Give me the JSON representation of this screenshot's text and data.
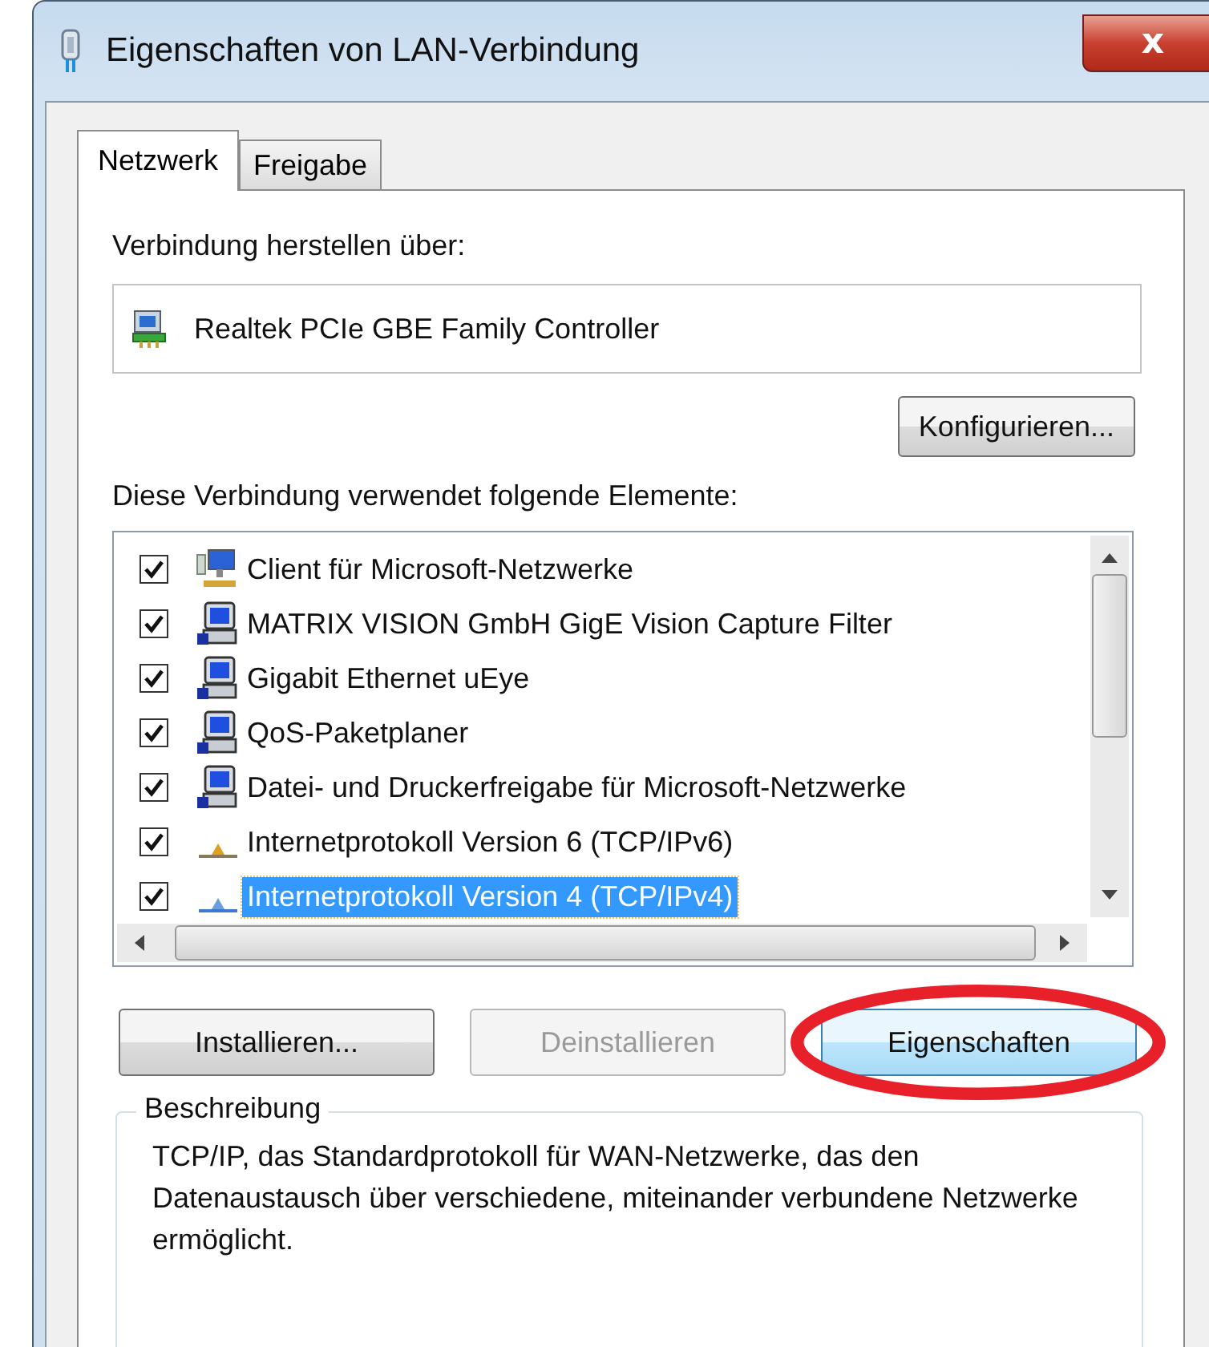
{
  "window": {
    "title": "Eigenschaften von LAN-Verbindung",
    "close_label": "x"
  },
  "tabs": [
    {
      "label": "Netzwerk",
      "selected": true
    },
    {
      "label": "Freigabe",
      "selected": false
    }
  ],
  "connect_label": "Verbindung herstellen über:",
  "adapter": "Realtek PCIe GBE Family Controller",
  "configure_button": "Konfigurieren...",
  "elements_label": "Diese Verbindung verwendet folgende Elemente:",
  "elements": [
    {
      "label": "Client für Microsoft-Netzwerke",
      "kind": "client",
      "checked": true,
      "selected": false
    },
    {
      "label": "MATRIX VISION GmbH GigE Vision Capture Filter",
      "kind": "service",
      "checked": true,
      "selected": false
    },
    {
      "label": "Gigabit Ethernet uEye",
      "kind": "service",
      "checked": true,
      "selected": false
    },
    {
      "label": "QoS-Paketplaner",
      "kind": "service",
      "checked": true,
      "selected": false
    },
    {
      "label": "Datei- und Druckerfreigabe für Microsoft-Netzwerke",
      "kind": "service",
      "checked": true,
      "selected": false
    },
    {
      "label": "Internetprotokoll Version 6 (TCP/IPv6)",
      "kind": "protocol",
      "checked": true,
      "selected": false
    },
    {
      "label": "Internetprotokoll Version 4 (TCP/IPv4)",
      "kind": "protocol",
      "checked": true,
      "selected": true
    }
  ],
  "buttons": [
    {
      "label": "Installieren...",
      "disabled": false,
      "focused": false
    },
    {
      "label": "Deinstallieren",
      "disabled": true,
      "focused": false
    },
    {
      "label": "Eigenschaften",
      "disabled": false,
      "focused": true
    }
  ],
  "description": {
    "title": "Beschreibung",
    "text": "TCP/IP, das Standardprotokoll für WAN-Netzwerke, das den Datenaustausch über verschiedene, miteinander verbundene Netzwerke ermöglicht."
  },
  "annotation": {
    "kind": "ellipse"
  }
}
